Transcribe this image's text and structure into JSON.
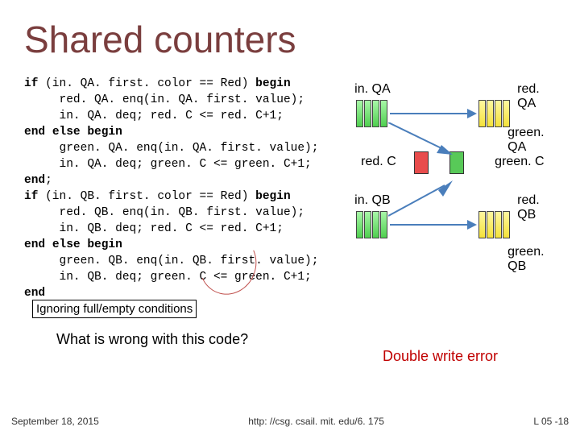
{
  "title": "Shared counters",
  "code_lines": [
    "if (in. QA. first. color == Red) begin",
    "     red. QA. enq(in. QA. first. value);",
    "     in. QA. deq; red. C <= red. C+1;",
    "end else begin",
    "     green. QA. enq(in. QA. first. value);",
    "     in. QA. deq; green. C <= green. C+1;",
    "end;",
    "if (in. QB. first. color == Red) begin",
    "     red. QB. enq(in. QB. first. value);",
    "     in. QB. deq; red. C <= red. C+1;",
    "end else begin",
    "     green. QB. enq(in. QB. first. value);",
    "     in. QB. deq; green. C <= green. C+1;",
    "end"
  ],
  "note": "Ignoring full/empty conditions",
  "question": "What is wrong with this code?",
  "error": "Double write error",
  "footer": {
    "left": "September 18, 2015",
    "center": "http: //csg. csail. mit. edu/6. 175",
    "right": "L 05 -18"
  },
  "diagram": {
    "inQA": "in. QA",
    "redQA": "red. QA",
    "greenQA": "green. QA",
    "redC": "red. C",
    "greenC": "green. C",
    "inQB": "in. QB",
    "redQB": "red. QB",
    "greenQB": "green. QB"
  }
}
